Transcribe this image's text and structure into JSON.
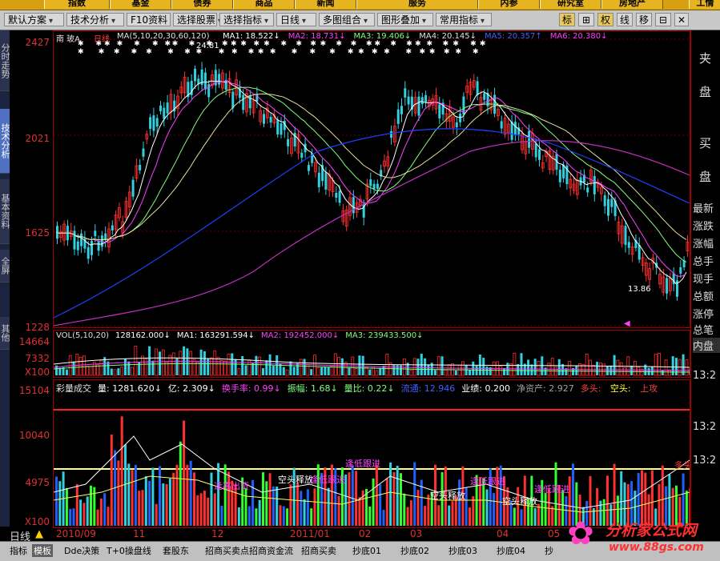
{
  "top_menu": [
    "指数",
    "基金",
    "债券",
    "商品",
    "新闻",
    "服务",
    "内参",
    "研究室",
    "房地产",
    "工情"
  ],
  "toolbar": {
    "buttons": [
      "默认方案",
      "技术分析",
      "F10资料",
      "选择股票",
      "选择指标",
      "日线",
      "多图组合",
      "图形叠加",
      "常用指标"
    ],
    "small_buttons": [
      "标",
      "⊞",
      "权",
      "线",
      "移",
      "⊟"
    ]
  },
  "left_tabs": [
    "分时走势",
    "技术分析",
    "基本资料",
    "全屏",
    "其他"
  ],
  "chart": {
    "stock_name": "南  玻A",
    "period": "日线",
    "ma_legend": "MA(5,10,20,30,60,120)",
    "ma_values": [
      {
        "label": "MA1: 18.522↓",
        "color": "#ffffff"
      },
      {
        "label": "MA2: 18.731↓",
        "color": "#ff40ff"
      },
      {
        "label": "MA3: 19.406↓",
        "color": "#80ff80"
      },
      {
        "label": "MA4: 20.145↓",
        "color": "#e0e0e0"
      },
      {
        "label": "MA5: 20.357↑",
        "color": "#4060ff"
      },
      {
        "label": "MA6: 20.380↓",
        "color": "#ff40ff"
      }
    ],
    "y_ticks": [
      "2427",
      "2021",
      "1625",
      "1228"
    ],
    "high_label": "24.81",
    "low_label": "13.86"
  },
  "volume": {
    "legend": "VOL(5,10,20)",
    "values": [
      {
        "label": "128162.000↓",
        "color": "#ffffff"
      },
      {
        "label": "MA1: 163291.594↓",
        "color": "#ffffff"
      },
      {
        "label": "MA2: 192452.000↓",
        "color": "#ff40ff"
      },
      {
        "label": "MA3: 239433.500↓",
        "color": "#80ff80"
      }
    ],
    "y_ticks": [
      "14664",
      "7332",
      "X100"
    ]
  },
  "indicator": {
    "legend_items": [
      {
        "label": "彩量成交",
        "color": "#e0e0e0"
      },
      {
        "label": "量: 1281.620↓",
        "color": "#ffffff"
      },
      {
        "label": "亿: 2.309↓",
        "color": "#ffffff"
      },
      {
        "label": "换手率: 0.99↓",
        "color": "#ff40ff"
      },
      {
        "label": "振幅: 1.68↓",
        "color": "#80ff80"
      },
      {
        "label": "量比: 0.22↓",
        "color": "#80ff80"
      },
      {
        "label": "流通: 12.946",
        "color": "#4060ff"
      },
      {
        "label": "业绩: 0.200",
        "color": "#ffffff"
      },
      {
        "label": "净资产: 2.927",
        "color": "#a0a0a0"
      },
      {
        "label": "多头: ",
        "color": "#ff4040"
      },
      {
        "label": "空头: ",
        "color": "#ffff40"
      },
      {
        "label": "上攻",
        "color": "#ff4040"
      }
    ],
    "y_ticks": [
      "15104",
      "10040",
      "4975",
      "X100"
    ],
    "annotations": [
      "逢低跟进",
      "空头释放",
      "逢高出货",
      "逢低跟进",
      "空头释放",
      "逢低跟进",
      "空头释放",
      "逢低跟进",
      "多头信号"
    ]
  },
  "time_axis": [
    "2010/09",
    "11",
    "12",
    "2011/01",
    "02",
    "03",
    "04",
    "05"
  ],
  "period_label": "日线",
  "right_panel": {
    "labels": [
      "夹",
      "盘",
      "买",
      "盘"
    ],
    "quote_labels": [
      "最新",
      "涨跌",
      "涨幅",
      "总手",
      "现手",
      "总额",
      "涨停",
      "总笔",
      "内盘"
    ],
    "times": [
      "13:2",
      "13:2",
      "13:2"
    ]
  },
  "bottom_tabs": [
    "指标",
    "模板",
    "Dde决策",
    "T+0操盘线",
    "套股东",
    "招商买卖点",
    "招商资金流",
    "招商买卖",
    "抄底01",
    "抄底02",
    "抄底03",
    "抄底04",
    "抄"
  ],
  "watermark": {
    "text": "分析家公式网",
    "url": "www.88gs.com"
  },
  "colors": {
    "accent": "#d8a010",
    "axis": "#e03030",
    "up": "#ff3030",
    "down": "#30d0e0"
  }
}
